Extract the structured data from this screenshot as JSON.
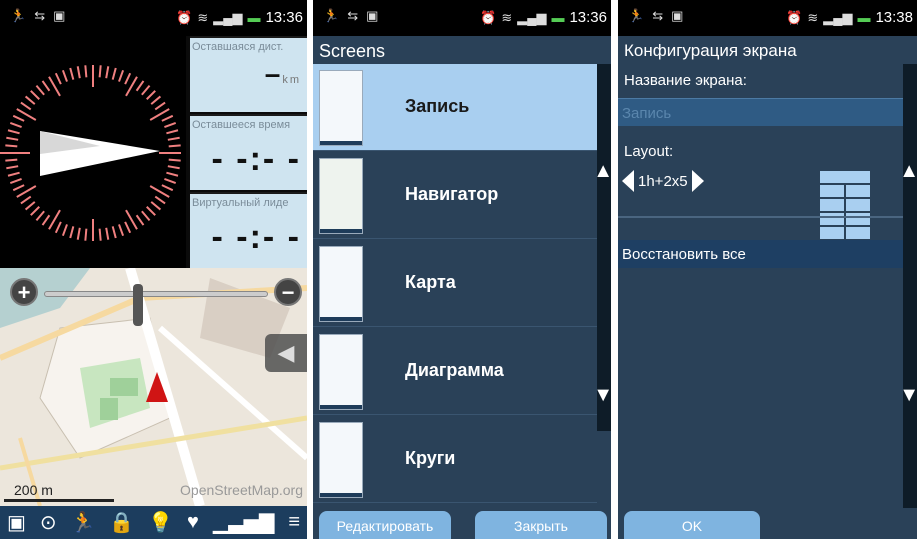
{
  "colors": {
    "accent": "#a9cff0",
    "panel": "#2a4158",
    "statusbar": "#000000",
    "compassTicks": "#f08080",
    "arrow": "#d01414"
  },
  "statusbar": {
    "time_1": "13:36",
    "time_2": "13:36",
    "time_3": "13:38",
    "icons": [
      "runner-icon",
      "usb-icon",
      "image-icon",
      "alarm-icon",
      "wifi-icon",
      "signal-icon",
      "battery-icon"
    ]
  },
  "screen1": {
    "tiles": [
      {
        "label": "Оставшаяся дист.",
        "value": "–",
        "unit": "km"
      },
      {
        "label": "Оставшееся время",
        "value": "- -:- -"
      },
      {
        "label": "Виртуальный лиде",
        "value": "- -:- -"
      }
    ],
    "map": {
      "scale": "200 m",
      "attribution": "OpenStreetMap.org"
    },
    "bottom_icons": [
      "device-icon",
      "play-icon",
      "runner-icon",
      "lock-icon",
      "bulb-icon",
      "heart-icon",
      "signal-icon",
      "menu-icon"
    ]
  },
  "screen2": {
    "title": "Screens",
    "items": [
      {
        "label": "Запись",
        "selected": true
      },
      {
        "label": "Навигатор",
        "selected": false
      },
      {
        "label": "Карта",
        "selected": false
      },
      {
        "label": "Диаграмма",
        "selected": false
      },
      {
        "label": "Круги",
        "selected": false
      }
    ],
    "edit_button": "Редактировать",
    "close_button": "Закрыть"
  },
  "screen3": {
    "title": "Конфигурация экрана",
    "name_label": "Название экрана:",
    "name_placeholder": "Запись",
    "layout_label": "Layout:",
    "layout_value": "1h+2x5",
    "restore_label": "Восстановить все",
    "ok_button": "OK"
  }
}
